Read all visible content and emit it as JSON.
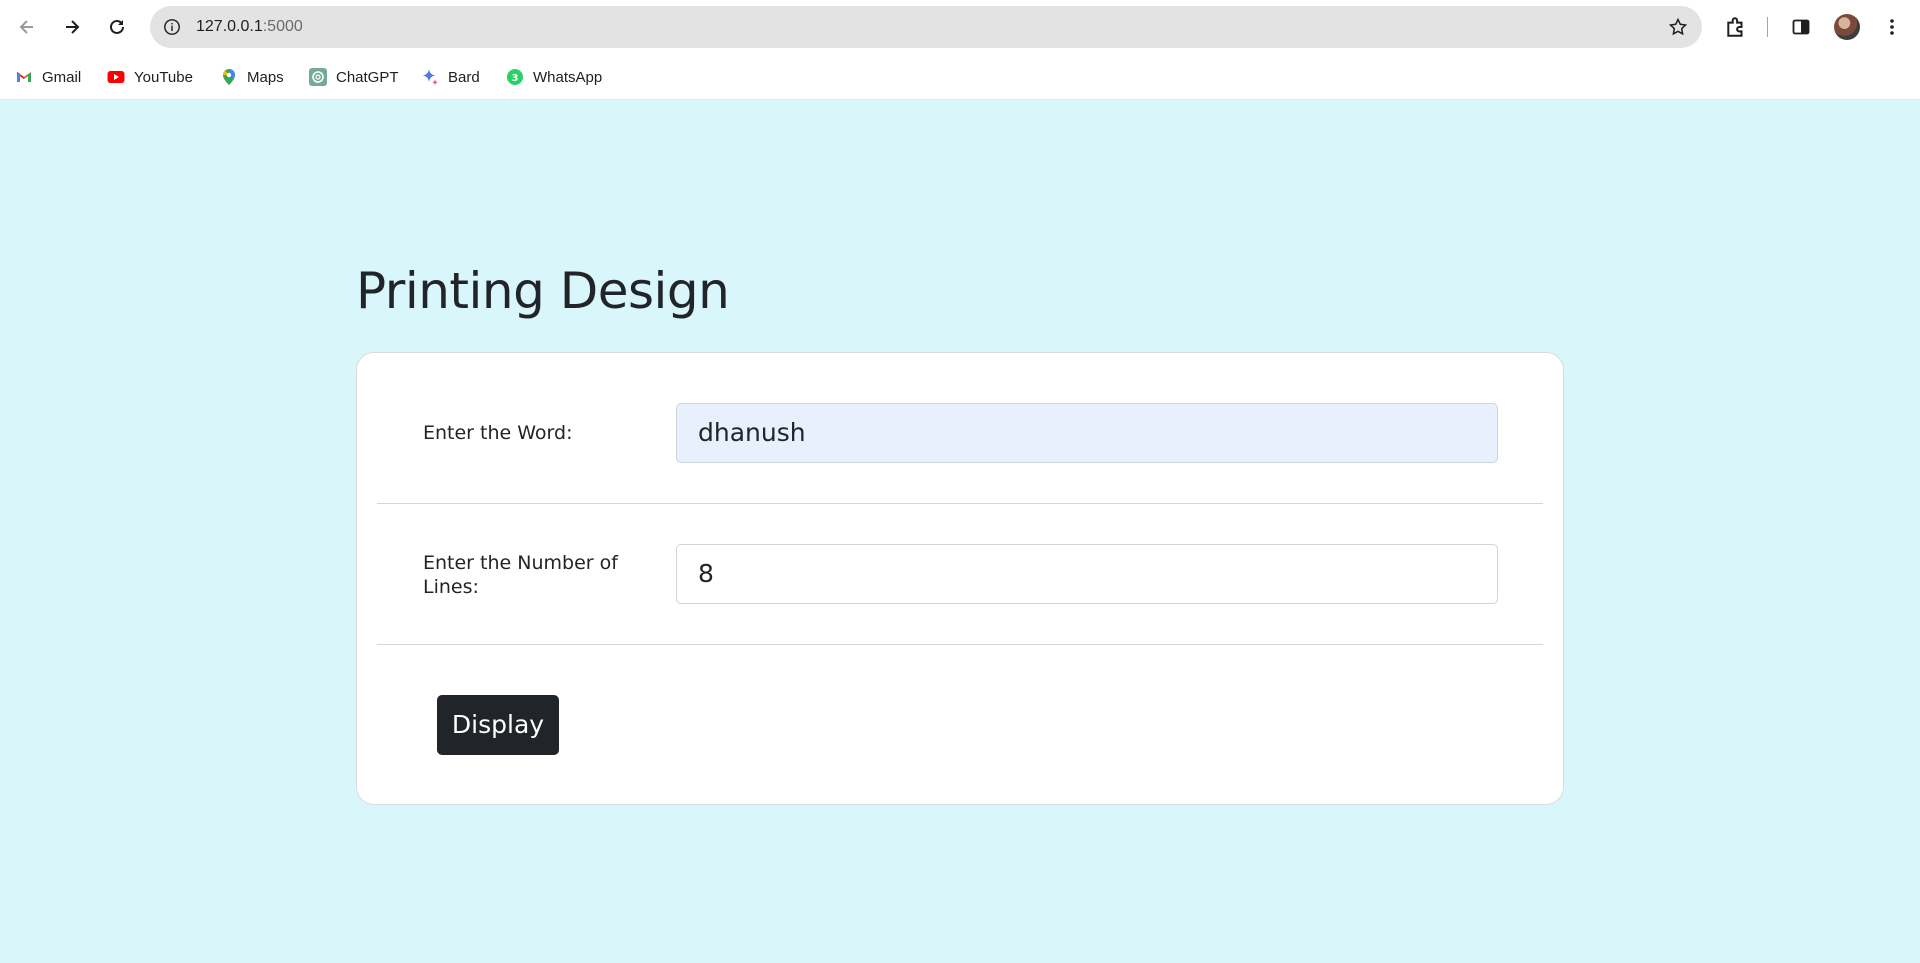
{
  "browser": {
    "url_host": "127.0.0.1",
    "url_port": ":5000",
    "bookmarks": [
      {
        "label": "Gmail",
        "icon": "gmail-icon"
      },
      {
        "label": "YouTube",
        "icon": "youtube-icon"
      },
      {
        "label": "Maps",
        "icon": "maps-icon"
      },
      {
        "label": "ChatGPT",
        "icon": "chatgpt-icon"
      },
      {
        "label": "Bard",
        "icon": "bard-icon"
      },
      {
        "label": "WhatsApp",
        "icon": "whatsapp-icon"
      }
    ]
  },
  "page": {
    "title": "Printing Design",
    "background_color": "#d9f6fb",
    "form": {
      "word_label": "Enter the Word:",
      "word_value": "dhanush",
      "lines_label_line1": "Enter the Number of",
      "lines_label_line2": "Lines:",
      "lines_value": "8",
      "submit_label": "Display"
    }
  }
}
